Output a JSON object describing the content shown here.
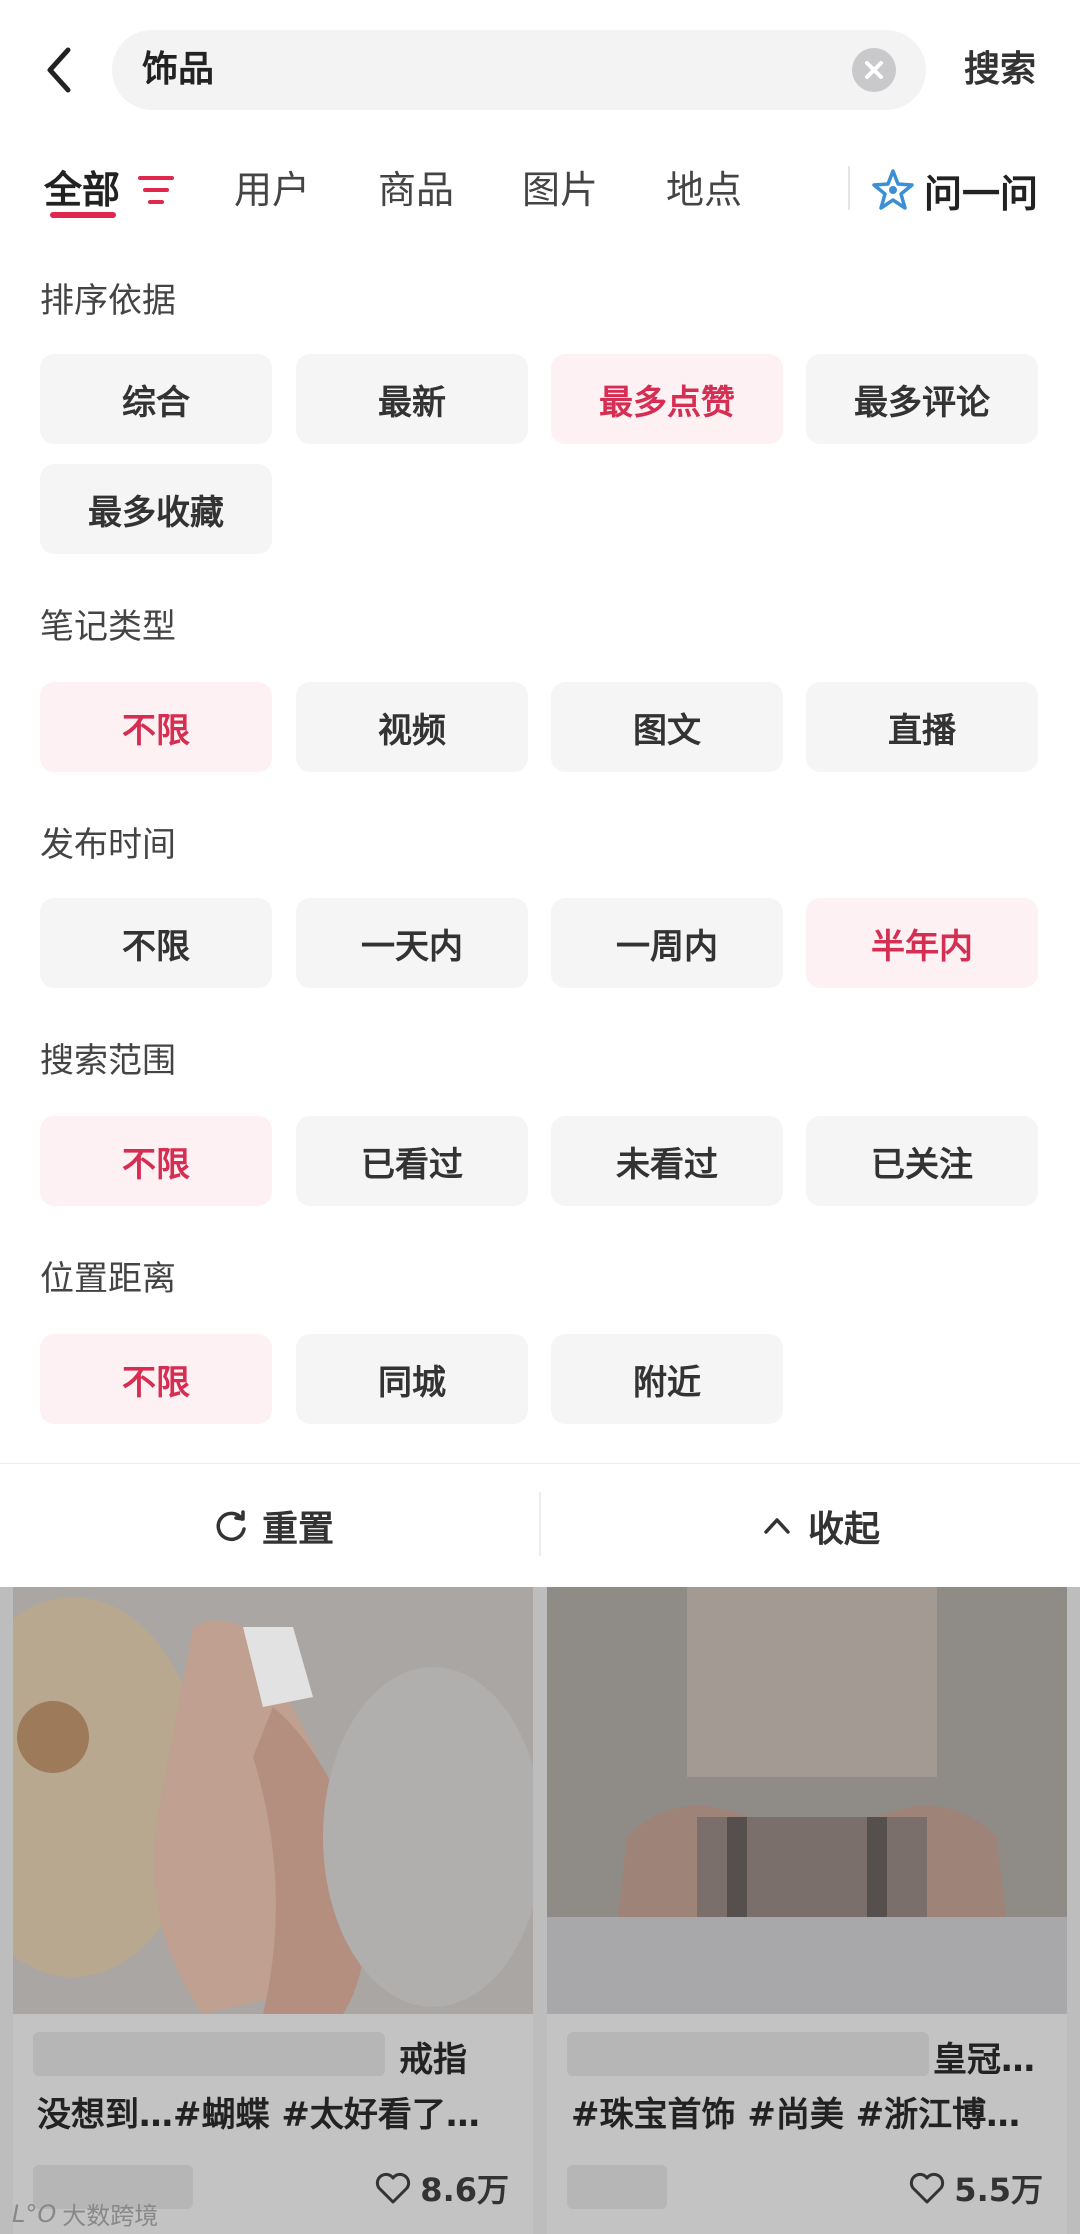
{
  "search": {
    "query": "饰品",
    "search_label": "搜索"
  },
  "tabs": [
    {
      "label": "全部",
      "active": true
    },
    {
      "label": "用户"
    },
    {
      "label": "商品"
    },
    {
      "label": "图片"
    },
    {
      "label": "地点"
    }
  ],
  "ask_label": "问一问",
  "filters": {
    "sort": {
      "title": "排序依据",
      "options": [
        "综合",
        "最新",
        "最多点赞",
        "最多评论",
        "最多收藏"
      ],
      "selected": "最多点赞"
    },
    "note_type": {
      "title": "笔记类型",
      "options": [
        "不限",
        "视频",
        "图文",
        "直播"
      ],
      "selected": "不限"
    },
    "publish_time": {
      "title": "发布时间",
      "options": [
        "不限",
        "一天内",
        "一周内",
        "半年内"
      ],
      "selected": "半年内"
    },
    "search_scope": {
      "title": "搜索范围",
      "options": [
        "不限",
        "已看过",
        "未看过",
        "已关注"
      ],
      "selected": "不限"
    },
    "distance": {
      "title": "位置距离",
      "options": [
        "不限",
        "同城",
        "附近"
      ],
      "selected": "不限"
    }
  },
  "actions": {
    "reset": "重置",
    "collapse": "收起"
  },
  "results": [
    {
      "title_visible": "戒指",
      "tags": "没想到…#蝴蝶 #太好看了…",
      "likes": "8.6万"
    },
    {
      "title_visible": "皇冠…",
      "tags": "#珠宝首饰 #尚美 #浙江博…",
      "likes": "5.5万"
    }
  ],
  "watermark": {
    "logo": "L°O",
    "text": "大数跨境"
  },
  "colors": {
    "accent": "#d62e52",
    "selected_bg": "#fdf1f3",
    "chip_bg": "#f5f5f6"
  }
}
